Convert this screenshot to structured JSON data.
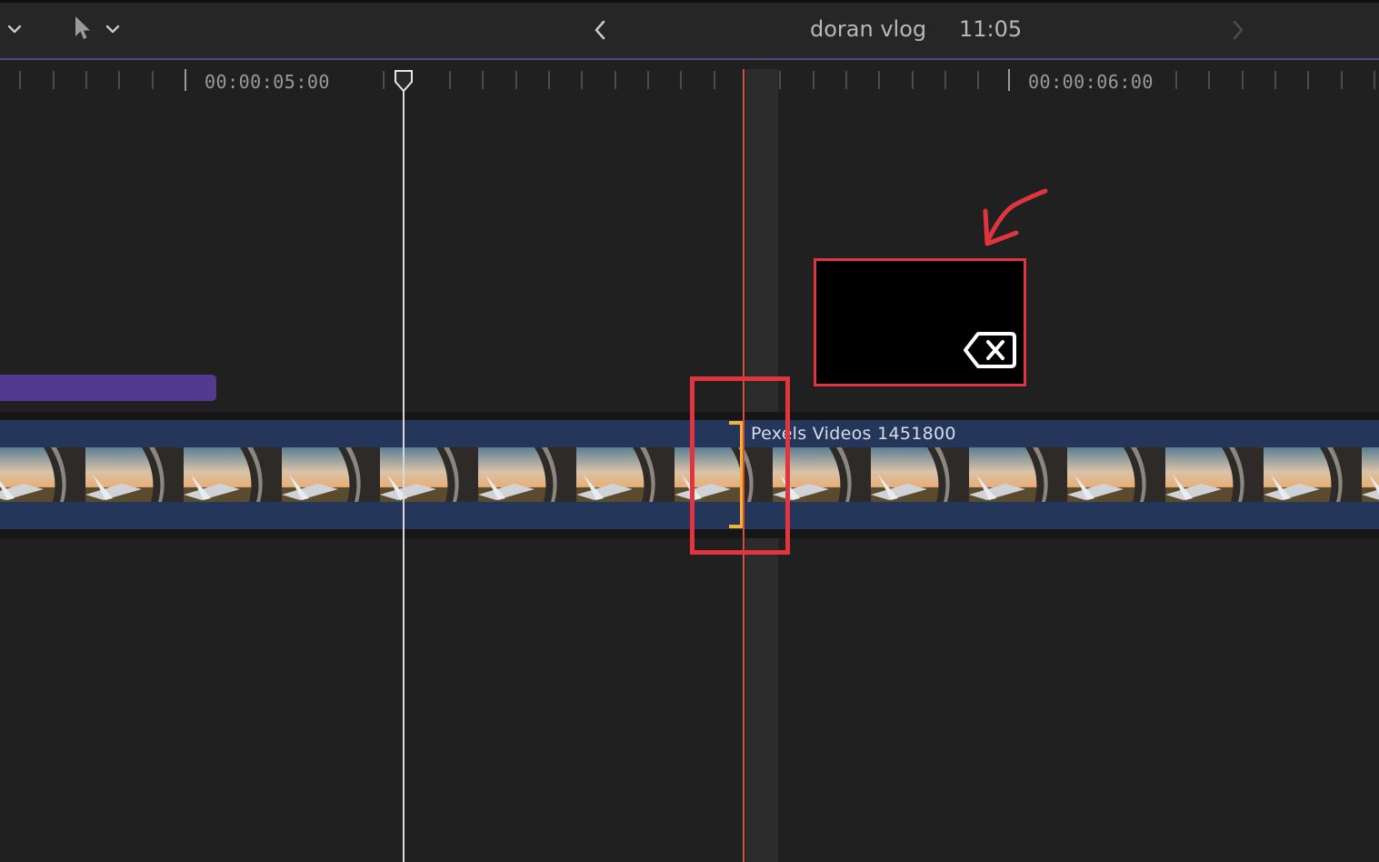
{
  "toolbar": {
    "project_name": "doran vlog",
    "project_duration": "11:05",
    "icons": [
      "chevron-down-icon",
      "pointer-tool-icon",
      "chevron-down-icon",
      "chevron-left-icon",
      "chevron-right-icon"
    ]
  },
  "ruler": {
    "timecodes": [
      "00:00:05:00",
      "00:00:06:00"
    ]
  },
  "timeline": {
    "primary_clip_name": "Pexels Videos 1451800",
    "title_clip_color": "#533a8e",
    "video_clip_color": "#24365a",
    "skimmer_color": "#d4503c",
    "trim_handle_color": "#f2b233"
  },
  "annotations": {
    "highlight_color": "#e0353f",
    "key_icon": "delete-key-icon"
  }
}
